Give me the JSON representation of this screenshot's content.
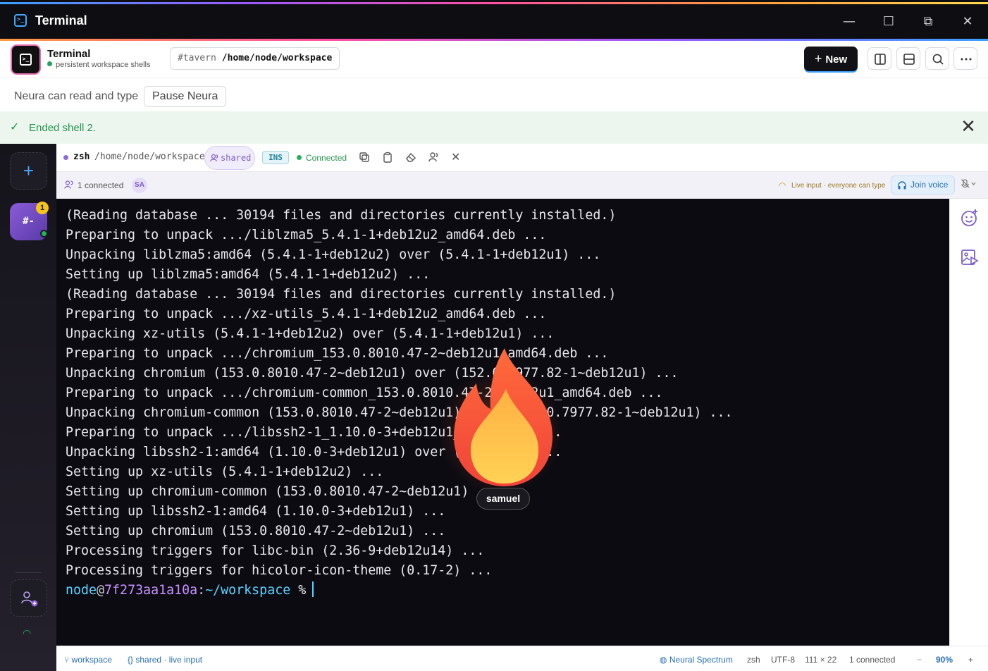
{
  "window": {
    "title": "Terminal",
    "controls": {
      "minimize": "—",
      "maximize": "☐",
      "snap": "⧉",
      "close": "✕"
    }
  },
  "header": {
    "title": "Terminal",
    "subtitle": "persistent workspace shells",
    "channel": "#tavern",
    "path": "/home/node/workspace",
    "new_label": "New"
  },
  "neura": {
    "status": "Neura can read and type",
    "pause_label": "Pause Neura"
  },
  "notice": {
    "message": "Ended shell 2."
  },
  "rail": {
    "workspace_glyph": "#-",
    "badge": "1"
  },
  "tab": {
    "shell": "zsh",
    "cwd": "/home/node/workspace",
    "shared_label": "shared",
    "mode": "INS",
    "status": "Connected"
  },
  "presence": {
    "count": "1 connected",
    "avatar": "SA",
    "live_input": "Live input · everyone can type",
    "join_voice": "Join voice"
  },
  "terminal": {
    "lines": [
      "(Reading database ... 30194 files and directories currently installed.)",
      "Preparing to unpack .../liblzma5_5.4.1-1+deb12u2_amd64.deb ...",
      "Unpacking liblzma5:amd64 (5.4.1-1+deb12u2) over (5.4.1-1+deb12u1) ...",
      "Setting up liblzma5:amd64 (5.4.1-1+deb12u2) ...",
      "(Reading database ... 30194 files and directories currently installed.)",
      "Preparing to unpack .../xz-utils_5.4.1-1+deb12u2_amd64.deb ...",
      "Unpacking xz-utils (5.4.1-1+deb12u2) over (5.4.1-1+deb12u1) ...",
      "Preparing to unpack .../chromium_153.0.8010.47-2~deb12u1_amd64.deb ...",
      "Unpacking chromium (153.0.8010.47-2~deb12u1) over (152.0.7977.82-1~deb12u1) ...",
      "Preparing to unpack .../chromium-common_153.0.8010.47-2~deb12u1_amd64.deb ...",
      "Unpacking chromium-common (153.0.8010.47-2~deb12u1) over (152.0.7977.82-1~deb12u1) ...",
      "Preparing to unpack .../libssh2-1_1.10.0-3+deb12u1_amd64.deb ...",
      "Unpacking libssh2-1:amd64 (1.10.0-3+deb12u1) over (1.10.0-3) ...",
      "Setting up xz-utils (5.4.1-1+deb12u2) ...",
      "Setting up chromium-common (153.0.8010.47-2~deb12u1) ...",
      "Setting up libssh2-1:amd64 (1.10.0-3+deb12u1) ...",
      "Setting up chromium (153.0.8010.47-2~deb12u1) ...",
      "Processing triggers for libc-bin (2.36-9+deb12u14) ...",
      "Processing triggers for hicolor-icon-theme (0.17-2) ..."
    ],
    "prompt": {
      "user": "node",
      "at": "@",
      "host": "7f273aa1a10a",
      "sep": ":",
      "path": "~/workspace",
      "symbol": "%"
    },
    "cursor_user": "samuel"
  },
  "statusbar": {
    "branch": "workspace",
    "mode": "shared · live input",
    "theme": "Neural Spectrum",
    "shell": "zsh",
    "encoding": "UTF-8",
    "size": "111 × 22",
    "connected": "1 connected",
    "zoom_minus": "−",
    "zoom": "90%",
    "zoom_plus": "+"
  },
  "colors": {
    "accent": "#46a8ff",
    "success": "#26934f",
    "purple": "#7b5cc8",
    "terminal_bg": "#0c0b12"
  },
  "icons": [
    "terminal-icon",
    "split-vertical-icon",
    "split-horizontal-icon",
    "search-icon",
    "more-icon",
    "check-icon",
    "close-icon",
    "plus-icon",
    "users-icon",
    "wifi-icon",
    "copy-icon",
    "clipboard-icon",
    "eraser-icon",
    "headphones-icon",
    "mic-off-icon",
    "emoji-add-icon",
    "media-icon",
    "flame-icon",
    "branch-icon",
    "braces-icon",
    "palette-icon"
  ]
}
